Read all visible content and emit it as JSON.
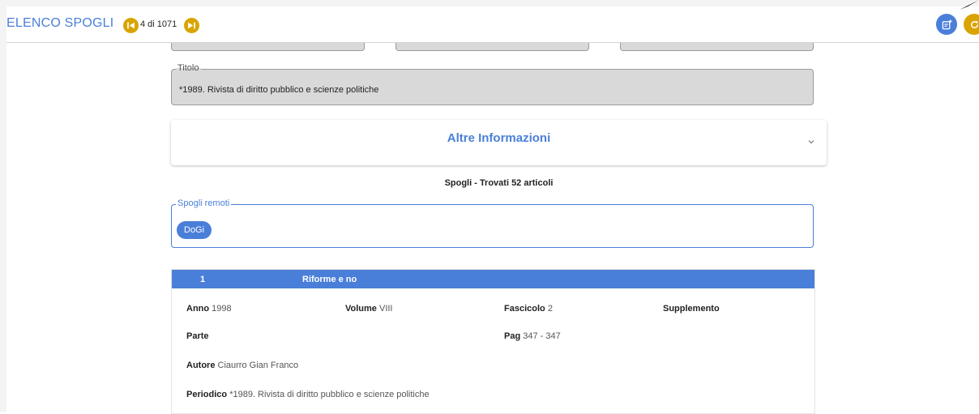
{
  "header": {
    "title": "ELENCO SPOGLI",
    "counter": "4 di 1071",
    "first_icon": "skip-previous-icon",
    "next_icon": "skip-next-icon",
    "add_icon": "note-add-icon",
    "refresh_icon": "refresh-icon"
  },
  "titolo": {
    "label": "Titolo",
    "value": "*1989. Rivista di diritto pubblico e scienze politiche"
  },
  "altre_informazioni": {
    "label": "Altre Informazioni",
    "icon": "chevron-down-icon"
  },
  "spogli_summary": "Spogli - Trovati 52 articoli",
  "spogli_remoti": {
    "label": "Spogli remoti",
    "chips": [
      "DoGi"
    ]
  },
  "article": {
    "number": "1",
    "title": "Riforme e no",
    "anno_label": "Anno",
    "anno": "1998",
    "volume_label": "Volume",
    "volume": "VIII",
    "fascicolo_label": "Fascicolo",
    "fascicolo": "2",
    "supplemento_label": "Supplemento",
    "parte_label": "Parte",
    "pag_label": "Pag",
    "pag": "347 - 347",
    "autore_label": "Autore",
    "autore": "Ciaurro Gian Franco",
    "periodico_label": "Periodico",
    "periodico": "*1989. Rivista di diritto pubblico e scienze politiche"
  },
  "colors": {
    "primary": "#4a7fd9",
    "accent": "#d9a400",
    "readonly_bg": "#d9d9d9"
  }
}
